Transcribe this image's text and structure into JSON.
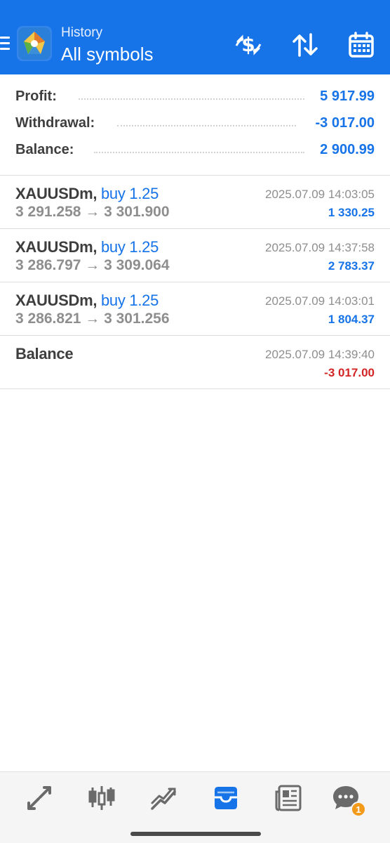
{
  "header": {
    "subtitle": "History",
    "title": "All symbols"
  },
  "summary": [
    {
      "label": "Profit:",
      "value": "5 917.99"
    },
    {
      "label": "Withdrawal:",
      "value": "-3 017.00"
    },
    {
      "label": "Balance:",
      "value": "2 900.99"
    }
  ],
  "deals": [
    {
      "symbol": "XAUUSDm,",
      "side": "buy 1.25",
      "prices": "3 291.258 → 3 301.900",
      "time": "2025.07.09 14:03:05",
      "profit": "1 330.25"
    },
    {
      "symbol": "XAUUSDm,",
      "side": "buy 1.25",
      "prices": "3 286.797 → 3 309.064",
      "time": "2025.07.09 14:37:58",
      "profit": "2 783.37"
    },
    {
      "symbol": "XAUUSDm,",
      "side": "buy 1.25",
      "prices": "3 286.821 → 3 301.256",
      "time": "2025.07.09 14:03:01",
      "profit": "1 804.37"
    },
    {
      "symbol": "Balance",
      "side": "",
      "prices": "",
      "time": "2025.07.09 14:39:40",
      "profit": "-3 017.00"
    }
  ],
  "nav": {
    "active": "history",
    "chat_badge": "1"
  },
  "colors": {
    "header_bg": "#1673e8",
    "positive": "#1673e8",
    "negative": "#d32525",
    "badge": "#f39a1a"
  }
}
